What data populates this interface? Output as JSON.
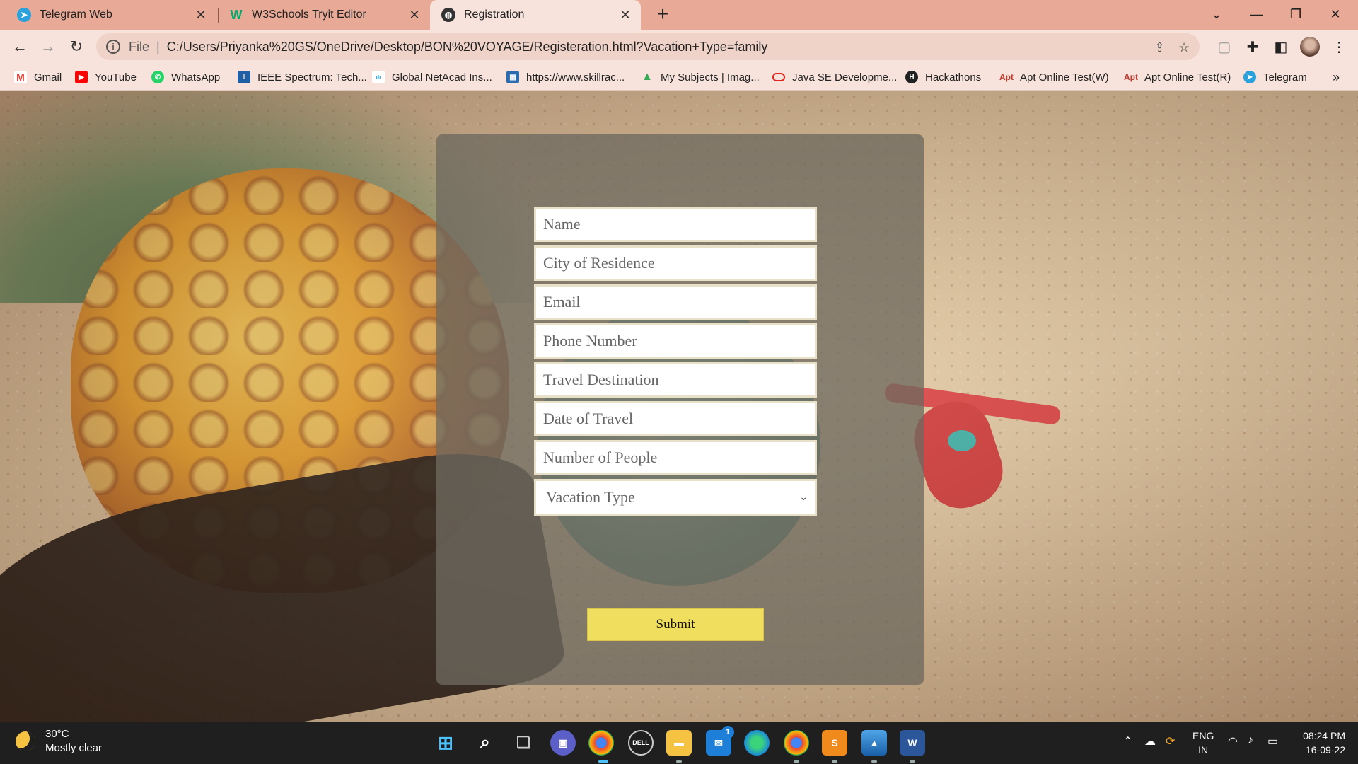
{
  "tabs": [
    {
      "title": "Telegram Web",
      "icon": "telegram-icon"
    },
    {
      "title": "W3Schools Tryit Editor",
      "icon": "w3schools-icon"
    },
    {
      "title": "Registration",
      "icon": "globe-icon",
      "active": true
    }
  ],
  "window_controls": {
    "dropdown": "⌄",
    "minimize": "—",
    "restore": "❐",
    "close": "✕"
  },
  "toolbar": {
    "scheme": "File",
    "url": "C:/Users/Priyanka%20GS/OneDrive/Desktop/BON%20VOYAGE/Registeration.html?Vacation+Type=family"
  },
  "bookmarks": [
    {
      "label": "Gmail",
      "icon": "gmail-icon",
      "color": "#ea4335"
    },
    {
      "label": "YouTube",
      "icon": "youtube-icon",
      "color": "#ff0000"
    },
    {
      "label": "WhatsApp",
      "icon": "whatsapp-icon",
      "color": "#25d366"
    },
    {
      "label": "IEEE Spectrum: Tech...",
      "icon": "ieee-icon",
      "color": "#1f5fa6"
    },
    {
      "label": "Global NetAcad Ins...",
      "icon": "cisco-icon",
      "color": "#1ba0d7"
    },
    {
      "label": "https://www.skillrac...",
      "icon": "skillrack-icon",
      "color": "#2b6cb0"
    },
    {
      "label": "My Subjects | Imag...",
      "icon": "drive-icon",
      "color": "#34a853"
    },
    {
      "label": "Java SE Developme...",
      "icon": "oracle-icon",
      "color": "#e2231a"
    },
    {
      "label": "Hackathons",
      "icon": "hackathons-icon",
      "color": "#222222"
    },
    {
      "label": "Apt Online Test(W)",
      "icon": "apt-icon",
      "color": "#c0392b"
    },
    {
      "label": "Apt Online Test(R)",
      "icon": "apt-icon",
      "color": "#c0392b"
    },
    {
      "label": "Telegram",
      "icon": "telegram-icon",
      "color": "#2aa1da"
    }
  ],
  "bookmarks_more": "»",
  "form": {
    "fields": [
      {
        "placeholder": "Name"
      },
      {
        "placeholder": "City of Residence"
      },
      {
        "placeholder": "Email"
      },
      {
        "placeholder": "Phone Number"
      },
      {
        "placeholder": "Travel Destination"
      },
      {
        "placeholder": "Date of Travel"
      },
      {
        "placeholder": "Number of People"
      }
    ],
    "select_label": "Vacation Type",
    "submit_label": "Submit",
    "submit_color": "#f0de5e"
  },
  "taskbar": {
    "weather_temp": "30°C",
    "weather_desc": "Mostly clear",
    "lang_line1": "ENG",
    "lang_line2": "IN",
    "time": "08:24 PM",
    "date": "16-09-22",
    "mail_badge": "1"
  }
}
